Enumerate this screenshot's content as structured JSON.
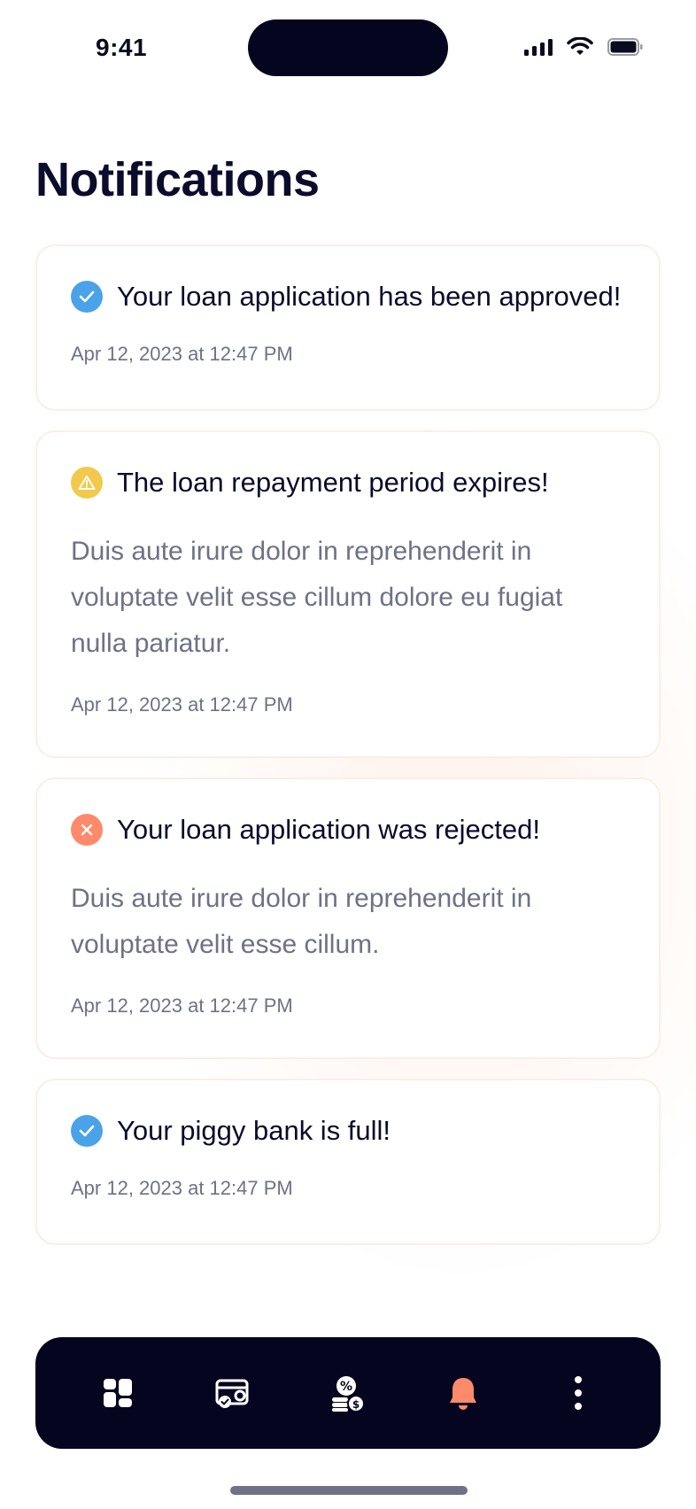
{
  "status_bar": {
    "time": "9:41"
  },
  "page": {
    "title": "Notifications"
  },
  "notifications": [
    {
      "type": "success",
      "title": "Your loan application has been approved!",
      "body": "",
      "time": "Apr 12, 2023 at 12:47 PM"
    },
    {
      "type": "warning",
      "title": "The loan repayment period expires!",
      "body": "Duis aute irure dolor in reprehenderit in voluptate velit esse cillum dolore eu fugiat nulla pariatur.",
      "time": "Apr 12, 2023 at 12:47 PM"
    },
    {
      "type": "error",
      "title": "Your loan application was rejected!",
      "body": "Duis aute irure dolor in reprehenderit in voluptate velit esse cillum.",
      "time": "Apr 12, 2023 at 12:47 PM"
    },
    {
      "type": "success",
      "title": "Your piggy bank is full!",
      "body": "",
      "time": "Apr 12, 2023 at 12:47 PM"
    }
  ],
  "colors": {
    "success": "#4aa3e8",
    "warning": "#f2c94c",
    "error": "#ff8a6b",
    "nav_bg": "#05051f",
    "nav_active": "#ff8a6b",
    "nav_inactive": "#ffffff"
  },
  "nav": {
    "items": [
      {
        "icon": "dashboard-icon",
        "active": false
      },
      {
        "icon": "wallet-card-icon",
        "active": false
      },
      {
        "icon": "coins-percent-icon",
        "active": false
      },
      {
        "icon": "bell-icon",
        "active": true
      },
      {
        "icon": "more-vertical-icon",
        "active": false
      }
    ]
  }
}
